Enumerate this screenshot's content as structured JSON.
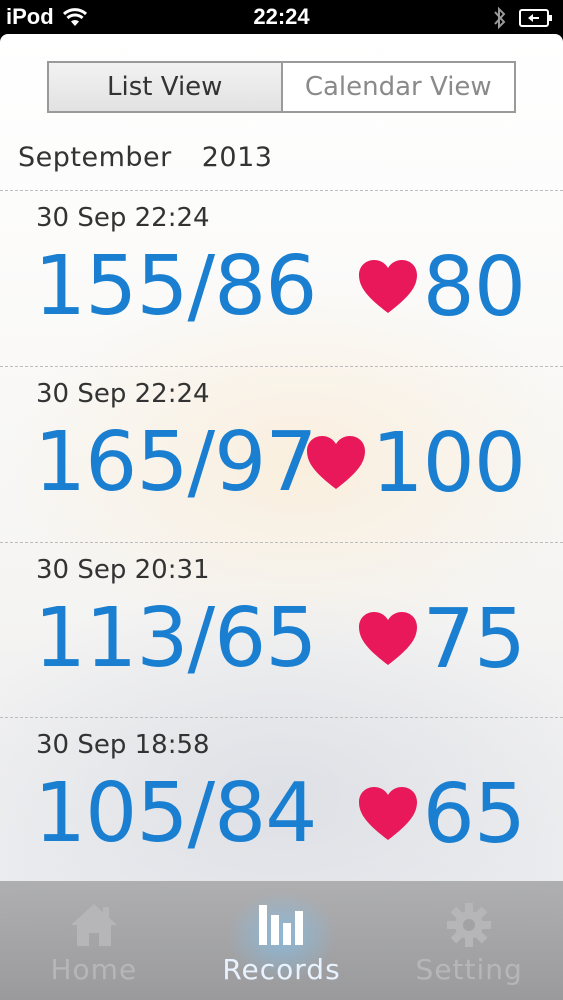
{
  "status_bar": {
    "carrier": "iPod",
    "time": "22:24"
  },
  "view_toggle": {
    "list_label": "List View",
    "calendar_label": "Calendar View",
    "selected": "List View"
  },
  "month_header": {
    "month": "September",
    "year": "2013"
  },
  "records": [
    {
      "time": "30 Sep 22:24",
      "bp": "155/86",
      "pulse": "80"
    },
    {
      "time": "30 Sep 22:24",
      "bp": "165/97",
      "pulse": "100"
    },
    {
      "time": "30 Sep 20:31",
      "bp": "113/65",
      "pulse": "75"
    },
    {
      "time": "30 Sep 18:58",
      "bp": "105/84",
      "pulse": "65"
    }
  ],
  "tab_bar": {
    "tabs": [
      {
        "label": "Home",
        "icon": "home-icon"
      },
      {
        "label": "Records",
        "icon": "bar-chart-icon"
      },
      {
        "label": "Setting",
        "icon": "gear-icon"
      }
    ],
    "active": "Records"
  },
  "colors": {
    "value_blue": "#1a7fd0",
    "heart_pink": "#e8185a",
    "tab_active_glow": "#78c8ff"
  }
}
